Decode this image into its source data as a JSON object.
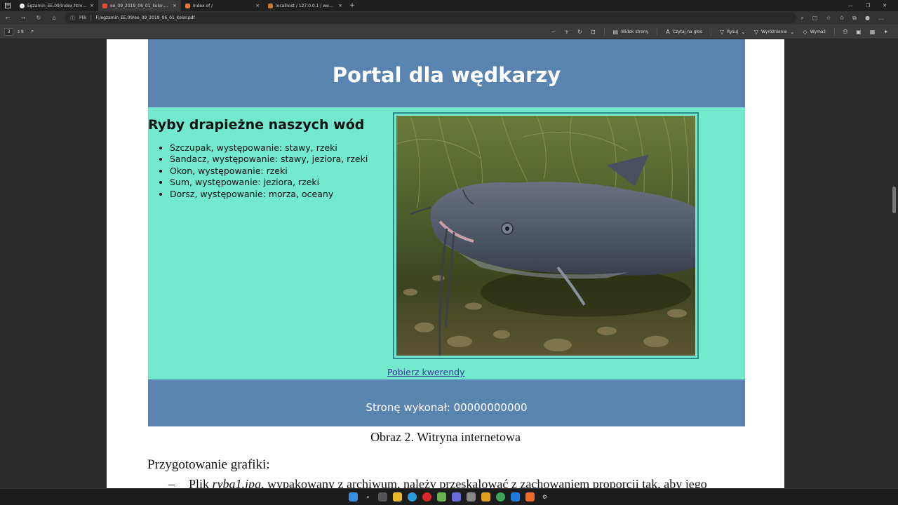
{
  "browser": {
    "tabs": [
      {
        "label": "Egzamin_EE.09/index.html at ma",
        "active": false,
        "favicon_color": "#e6e6e6"
      },
      {
        "label": "ee_09_2019_06_01_kolor.pdf",
        "active": true,
        "favicon_color": "#e04b3c"
      },
      {
        "label": "Index of /",
        "active": false,
        "favicon_color": "#e07a3c"
      },
      {
        "label": "localhost / 127.0.0.1 / wedkowa",
        "active": false,
        "favicon_color": "#c87a30"
      }
    ],
    "close_glyph": "×",
    "new_tab_glyph": "+",
    "window_controls": [
      "—",
      "❐",
      "✕"
    ],
    "address": {
      "scheme_label": "Plik",
      "url": "F:/egzamin_EE.09/ee_09_2019_06_01_kolor.pdf"
    }
  },
  "pdf_toolbar": {
    "page_number": "3",
    "page_count": "z 8",
    "tools": [
      {
        "label": "Widok strony",
        "icon": "page-view-icon"
      },
      {
        "label": "Czytaj na głos",
        "icon": "read-aloud-icon"
      },
      {
        "label": "Rysuj",
        "icon": "draw-icon"
      },
      {
        "label": "Wyróżnienie",
        "icon": "highlight-icon"
      },
      {
        "label": "Wymaż",
        "icon": "erase-icon"
      }
    ]
  },
  "website": {
    "header_title": "Portal dla wędkarzy",
    "section_title": "Ryby drapieżne naszych wód",
    "fish": [
      "Szczupak, występowanie: stawy, rzeki",
      "Sandacz, występowanie: stawy, jeziora, rzeki",
      "Okon, występowanie: rzeki",
      "Sum, występowanie: jeziora, rzeki",
      "Dorsz, występowanie: morza, oceany"
    ],
    "link_text": "Pobierz kwerendy",
    "footer_text": "Stronę wykonał: 00000000000",
    "colors": {
      "header": "#5a84b0",
      "main": "#72e8cc"
    }
  },
  "document": {
    "caption": "Obraz 2. Witryna internetowa",
    "section_heading": "Przygotowanie grafiki:",
    "bullet_dash": "–",
    "bullet_prefix": "Plik ",
    "bullet_filename": "ryba1.jpg",
    "bullet_rest": ", wypakowany z archiwum, należy przeskalować z zachowaniem proporcji tak, aby jego"
  }
}
